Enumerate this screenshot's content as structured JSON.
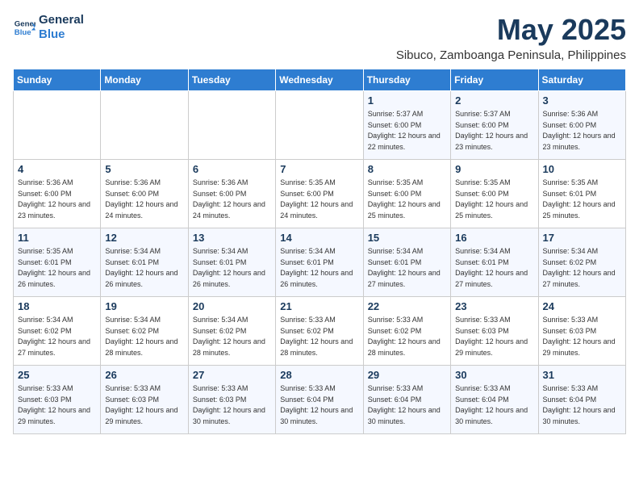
{
  "logo": {
    "line1": "General",
    "line2": "Blue"
  },
  "title": "May 2025",
  "subtitle": "Sibuco, Zamboanga Peninsula, Philippines",
  "days_of_week": [
    "Sunday",
    "Monday",
    "Tuesday",
    "Wednesday",
    "Thursday",
    "Friday",
    "Saturday"
  ],
  "weeks": [
    [
      {
        "day": "",
        "sunrise": "",
        "sunset": "",
        "daylight": ""
      },
      {
        "day": "",
        "sunrise": "",
        "sunset": "",
        "daylight": ""
      },
      {
        "day": "",
        "sunrise": "",
        "sunset": "",
        "daylight": ""
      },
      {
        "day": "",
        "sunrise": "",
        "sunset": "",
        "daylight": ""
      },
      {
        "day": "1",
        "sunrise": "Sunrise: 5:37 AM",
        "sunset": "Sunset: 6:00 PM",
        "daylight": "Daylight: 12 hours and 22 minutes."
      },
      {
        "day": "2",
        "sunrise": "Sunrise: 5:37 AM",
        "sunset": "Sunset: 6:00 PM",
        "daylight": "Daylight: 12 hours and 23 minutes."
      },
      {
        "day": "3",
        "sunrise": "Sunrise: 5:36 AM",
        "sunset": "Sunset: 6:00 PM",
        "daylight": "Daylight: 12 hours and 23 minutes."
      }
    ],
    [
      {
        "day": "4",
        "sunrise": "Sunrise: 5:36 AM",
        "sunset": "Sunset: 6:00 PM",
        "daylight": "Daylight: 12 hours and 23 minutes."
      },
      {
        "day": "5",
        "sunrise": "Sunrise: 5:36 AM",
        "sunset": "Sunset: 6:00 PM",
        "daylight": "Daylight: 12 hours and 24 minutes."
      },
      {
        "day": "6",
        "sunrise": "Sunrise: 5:36 AM",
        "sunset": "Sunset: 6:00 PM",
        "daylight": "Daylight: 12 hours and 24 minutes."
      },
      {
        "day": "7",
        "sunrise": "Sunrise: 5:35 AM",
        "sunset": "Sunset: 6:00 PM",
        "daylight": "Daylight: 12 hours and 24 minutes."
      },
      {
        "day": "8",
        "sunrise": "Sunrise: 5:35 AM",
        "sunset": "Sunset: 6:00 PM",
        "daylight": "Daylight: 12 hours and 25 minutes."
      },
      {
        "day": "9",
        "sunrise": "Sunrise: 5:35 AM",
        "sunset": "Sunset: 6:00 PM",
        "daylight": "Daylight: 12 hours and 25 minutes."
      },
      {
        "day": "10",
        "sunrise": "Sunrise: 5:35 AM",
        "sunset": "Sunset: 6:01 PM",
        "daylight": "Daylight: 12 hours and 25 minutes."
      }
    ],
    [
      {
        "day": "11",
        "sunrise": "Sunrise: 5:35 AM",
        "sunset": "Sunset: 6:01 PM",
        "daylight": "Daylight: 12 hours and 26 minutes."
      },
      {
        "day": "12",
        "sunrise": "Sunrise: 5:34 AM",
        "sunset": "Sunset: 6:01 PM",
        "daylight": "Daylight: 12 hours and 26 minutes."
      },
      {
        "day": "13",
        "sunrise": "Sunrise: 5:34 AM",
        "sunset": "Sunset: 6:01 PM",
        "daylight": "Daylight: 12 hours and 26 minutes."
      },
      {
        "day": "14",
        "sunrise": "Sunrise: 5:34 AM",
        "sunset": "Sunset: 6:01 PM",
        "daylight": "Daylight: 12 hours and 26 minutes."
      },
      {
        "day": "15",
        "sunrise": "Sunrise: 5:34 AM",
        "sunset": "Sunset: 6:01 PM",
        "daylight": "Daylight: 12 hours and 27 minutes."
      },
      {
        "day": "16",
        "sunrise": "Sunrise: 5:34 AM",
        "sunset": "Sunset: 6:01 PM",
        "daylight": "Daylight: 12 hours and 27 minutes."
      },
      {
        "day": "17",
        "sunrise": "Sunrise: 5:34 AM",
        "sunset": "Sunset: 6:02 PM",
        "daylight": "Daylight: 12 hours and 27 minutes."
      }
    ],
    [
      {
        "day": "18",
        "sunrise": "Sunrise: 5:34 AM",
        "sunset": "Sunset: 6:02 PM",
        "daylight": "Daylight: 12 hours and 27 minutes."
      },
      {
        "day": "19",
        "sunrise": "Sunrise: 5:34 AM",
        "sunset": "Sunset: 6:02 PM",
        "daylight": "Daylight: 12 hours and 28 minutes."
      },
      {
        "day": "20",
        "sunrise": "Sunrise: 5:34 AM",
        "sunset": "Sunset: 6:02 PM",
        "daylight": "Daylight: 12 hours and 28 minutes."
      },
      {
        "day": "21",
        "sunrise": "Sunrise: 5:33 AM",
        "sunset": "Sunset: 6:02 PM",
        "daylight": "Daylight: 12 hours and 28 minutes."
      },
      {
        "day": "22",
        "sunrise": "Sunrise: 5:33 AM",
        "sunset": "Sunset: 6:02 PM",
        "daylight": "Daylight: 12 hours and 28 minutes."
      },
      {
        "day": "23",
        "sunrise": "Sunrise: 5:33 AM",
        "sunset": "Sunset: 6:03 PM",
        "daylight": "Daylight: 12 hours and 29 minutes."
      },
      {
        "day": "24",
        "sunrise": "Sunrise: 5:33 AM",
        "sunset": "Sunset: 6:03 PM",
        "daylight": "Daylight: 12 hours and 29 minutes."
      }
    ],
    [
      {
        "day": "25",
        "sunrise": "Sunrise: 5:33 AM",
        "sunset": "Sunset: 6:03 PM",
        "daylight": "Daylight: 12 hours and 29 minutes."
      },
      {
        "day": "26",
        "sunrise": "Sunrise: 5:33 AM",
        "sunset": "Sunset: 6:03 PM",
        "daylight": "Daylight: 12 hours and 29 minutes."
      },
      {
        "day": "27",
        "sunrise": "Sunrise: 5:33 AM",
        "sunset": "Sunset: 6:03 PM",
        "daylight": "Daylight: 12 hours and 30 minutes."
      },
      {
        "day": "28",
        "sunrise": "Sunrise: 5:33 AM",
        "sunset": "Sunset: 6:04 PM",
        "daylight": "Daylight: 12 hours and 30 minutes."
      },
      {
        "day": "29",
        "sunrise": "Sunrise: 5:33 AM",
        "sunset": "Sunset: 6:04 PM",
        "daylight": "Daylight: 12 hours and 30 minutes."
      },
      {
        "day": "30",
        "sunrise": "Sunrise: 5:33 AM",
        "sunset": "Sunset: 6:04 PM",
        "daylight": "Daylight: 12 hours and 30 minutes."
      },
      {
        "day": "31",
        "sunrise": "Sunrise: 5:33 AM",
        "sunset": "Sunset: 6:04 PM",
        "daylight": "Daylight: 12 hours and 30 minutes."
      }
    ]
  ]
}
